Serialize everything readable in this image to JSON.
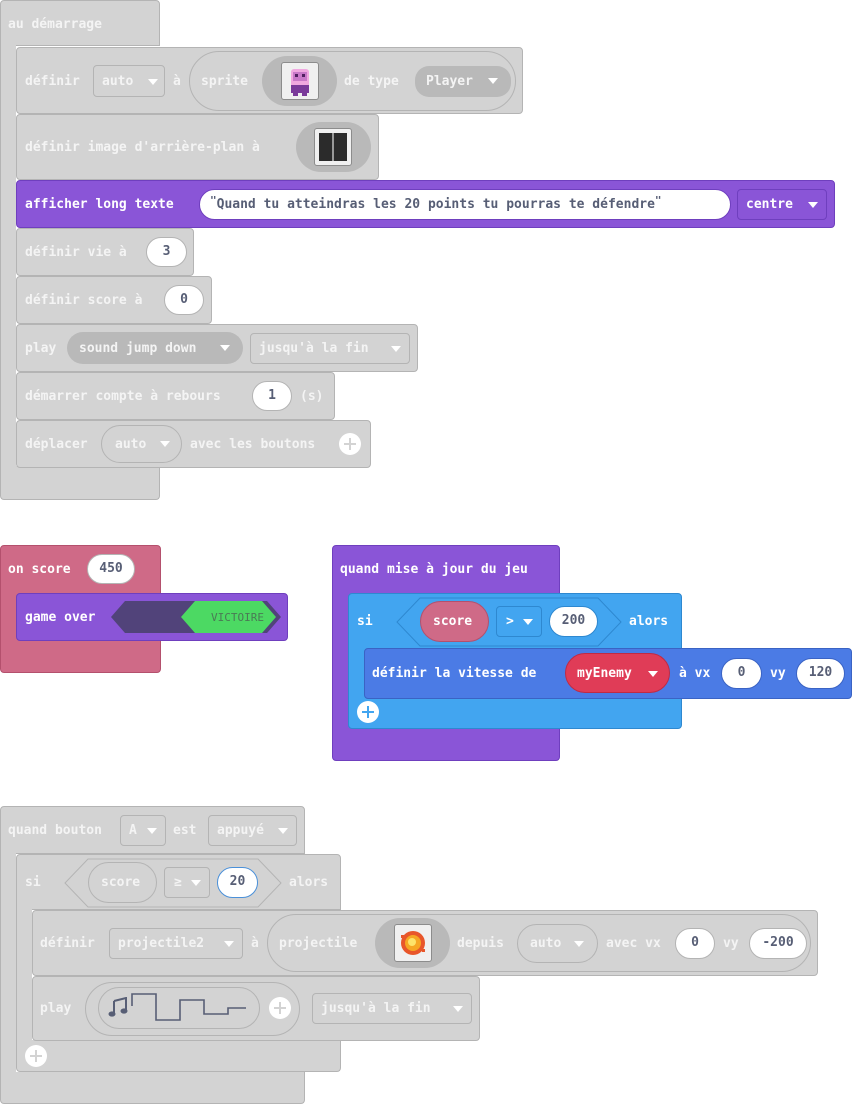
{
  "stack1": {
    "hat": "au démarrage",
    "set_sprite": {
      "define": "définir",
      "var": "auto",
      "to": "à",
      "sprite": "sprite",
      "of_type": "de type",
      "kind": "Player"
    },
    "set_bg": {
      "label": "définir image d'arrière-plan à"
    },
    "long_text": {
      "label": "afficher long texte",
      "text": "Quand tu atteindras les 20 points tu pourras te défendre",
      "position": "centre"
    },
    "life": {
      "label": "définir vie à",
      "value": "3"
    },
    "score": {
      "label": "définir score à",
      "value": "0"
    },
    "play": {
      "label": "play",
      "sound": "sound jump down",
      "until": "jusqu'à la fin"
    },
    "countdown": {
      "label": "démarrer compte à rebours",
      "value": "1",
      "unit": "(s)"
    },
    "move": {
      "label": "déplacer",
      "var": "auto",
      "with": "avec les boutons"
    }
  },
  "stack2": {
    "hat": "on score",
    "value": "450",
    "gameover": {
      "label": "game over",
      "toggle": "VICTOIRE"
    }
  },
  "stack3": {
    "hat": "quand mise à jour du jeu",
    "if_label": "si",
    "cond": {
      "var": "score",
      "op": ">",
      "value": "200"
    },
    "then_label": "alors",
    "velocity": {
      "label": "définir la vitesse de",
      "target": "myEnemy",
      "vx_label": "à vx",
      "vx": "0",
      "vy_label": "vy",
      "vy": "120"
    }
  },
  "stack4": {
    "hat": {
      "prefix": "quand bouton",
      "button": "A",
      "mid": "est",
      "state": "appuyé"
    },
    "if_label": "si",
    "cond": {
      "var": "score",
      "op": "≥",
      "value": "20"
    },
    "then_label": "alors",
    "projectile": {
      "define": "définir",
      "var": "projectile2",
      "to": "à",
      "kind": "projectile",
      "from": "depuis",
      "source": "auto",
      "vx_label": "avec vx",
      "vx": "0",
      "vy_label": "vy",
      "vy": "-200"
    },
    "play": {
      "label": "play",
      "until": "jusqu'à la fin"
    }
  },
  "colors": {
    "disabled": "#d3d3d3",
    "looks_purple": "#8a55d7",
    "info_pink": "#cf6a87",
    "logic_blue": "#42a5f0",
    "sprites_blue": "#4b7be5",
    "victory_green": "#4cd963",
    "enemy_red": "#e03c57"
  }
}
